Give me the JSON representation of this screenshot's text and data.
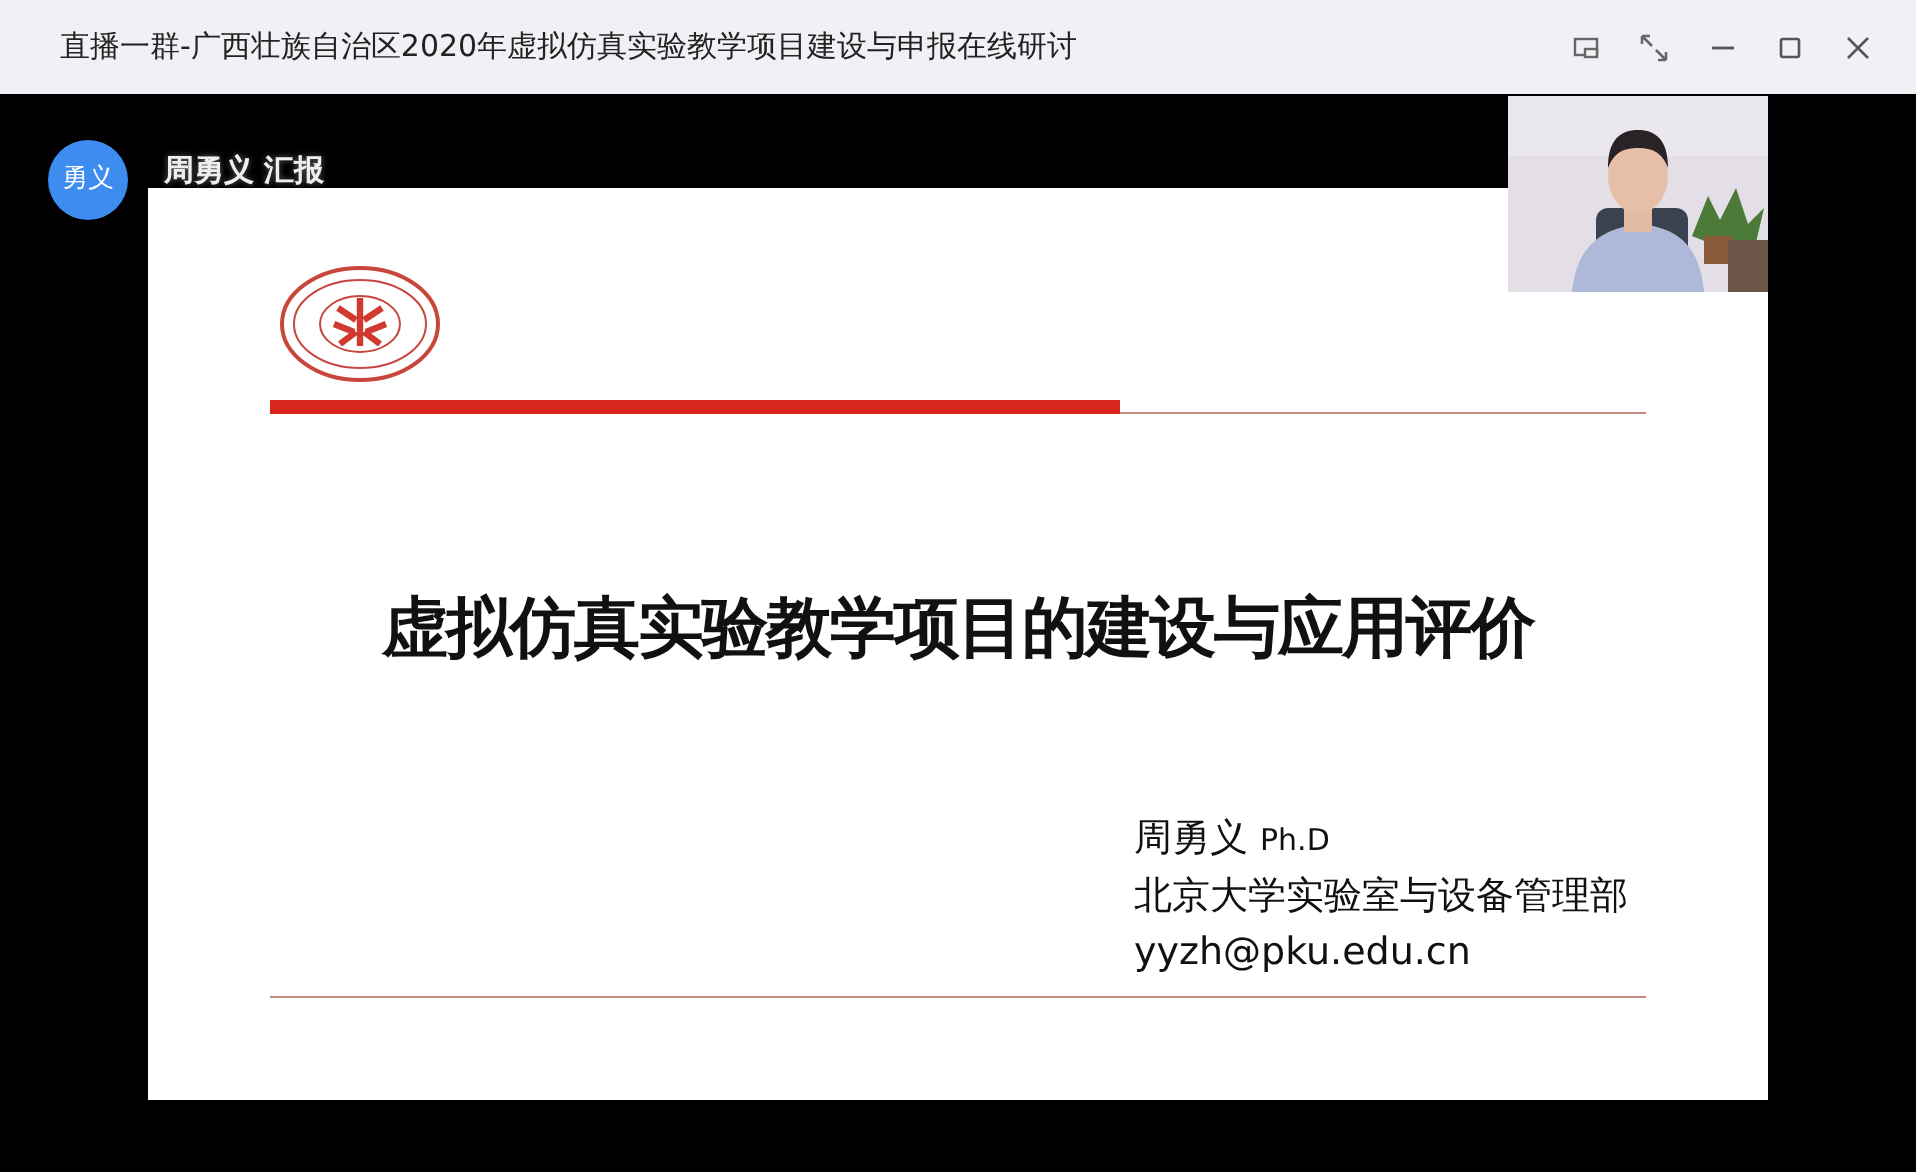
{
  "window": {
    "title": "直播一群-广西壮族自治区2020年虚拟仿真实验教学项目建设与申报在线研讨"
  },
  "presenter": {
    "avatar_text": "勇义",
    "caption": "周勇义 汇报"
  },
  "slide": {
    "title": "虚拟仿真实验教学项目的建设与应用评价",
    "author": "周勇义",
    "degree": "Ph.D",
    "department": "北京大学实验室与设备管理部",
    "email": "yyzh@pku.edu.cn"
  }
}
